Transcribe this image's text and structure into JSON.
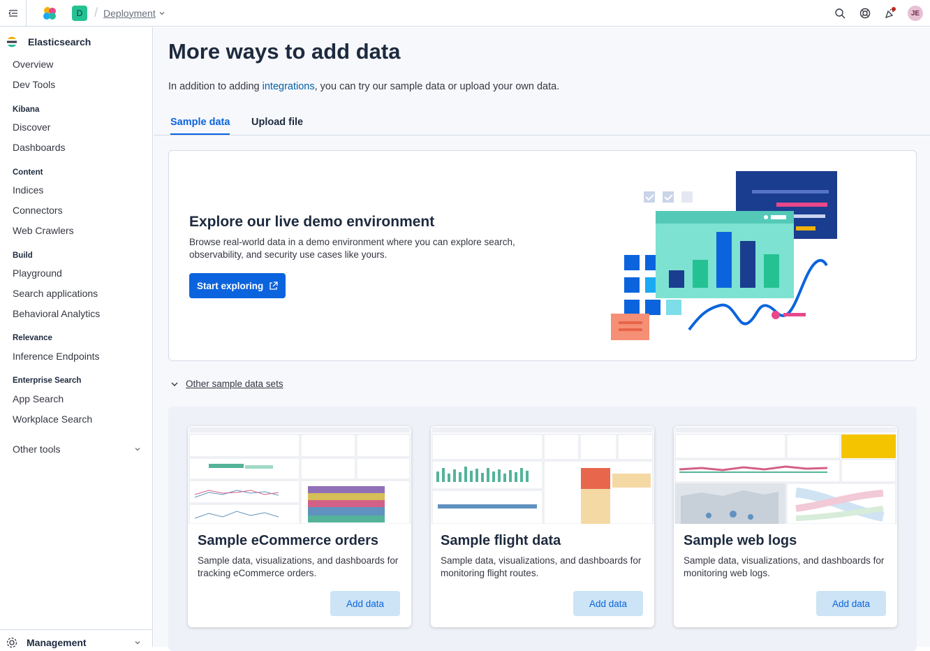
{
  "header": {
    "deployment_badge": "D",
    "breadcrumb": "Deployment",
    "avatar_initials": "JE",
    "icons": [
      "menu-icon",
      "elastic-logo-icon",
      "search-icon",
      "help-icon",
      "news-icon"
    ]
  },
  "sidebar": {
    "title": "Elasticsearch",
    "items": {
      "overview": "Overview",
      "dev_tools": "Dev Tools",
      "kibana": "Kibana",
      "discover": "Discover",
      "dashboards": "Dashboards",
      "content": "Content",
      "indices": "Indices",
      "connectors": "Connectors",
      "web_crawlers": "Web Crawlers",
      "build": "Build",
      "playground": "Playground",
      "search_applications": "Search applications",
      "behavioral_analytics": "Behavioral Analytics",
      "relevance": "Relevance",
      "inference_endpoints": "Inference Endpoints",
      "enterprise_search": "Enterprise Search",
      "app_search": "App Search",
      "workplace_search": "Workplace Search"
    },
    "other_tools": "Other tools",
    "management": "Management"
  },
  "main": {
    "title": "More ways to add data",
    "desc_prefix": "In addition to adding ",
    "desc_link": "integrations",
    "desc_suffix": ", you can try our sample data or upload your own data.",
    "tabs": {
      "sample": "Sample data",
      "upload": "Upload file"
    },
    "demo": {
      "title": "Explore our live demo environment",
      "desc": "Browse real-world data in a demo environment where you can explore search, observability, and security use cases like yours.",
      "button": "Start exploring"
    },
    "other_sets": "Other sample data sets",
    "cards": {
      "ecommerce": {
        "title": "Sample eCommerce orders",
        "desc": "Sample data, visualizations, and dashboards for tracking eCommerce orders.",
        "button": "Add data"
      },
      "flights": {
        "title": "Sample flight data",
        "desc": "Sample data, visualizations, and dashboards for monitoring flight routes.",
        "button": "Add data"
      },
      "logs": {
        "title": "Sample web logs",
        "desc": "Sample data, visualizations, and dashboards for monitoring web logs.",
        "button": "Add data"
      }
    }
  },
  "colors": {
    "primary": "#0b64dd",
    "accent_teal": "#24c292",
    "link": "#0061a6"
  }
}
